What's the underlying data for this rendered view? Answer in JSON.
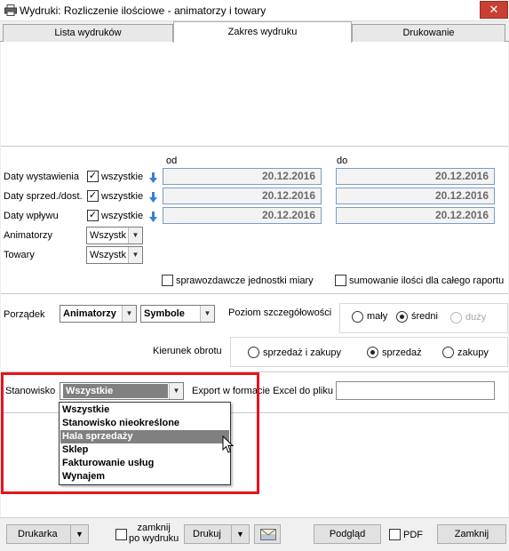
{
  "window": {
    "title": "Wydruki: Rozliczenie ilościowe - animatorzy i towary",
    "close_label": "✕"
  },
  "tabs": [
    {
      "label": "Lista wydruków"
    },
    {
      "label": "Zakres wydruku"
    },
    {
      "label": "Drukowanie"
    }
  ],
  "range": {
    "from_header": "od",
    "to_header": "do",
    "rows": [
      {
        "label": "Daty wystawienia",
        "all_label": "wszystkie",
        "checked": true,
        "from": "20.12.2016",
        "to": "20.12.2016"
      },
      {
        "label": "Daty sprzed./dost.",
        "all_label": "wszystkie",
        "checked": true,
        "from": "20.12.2016",
        "to": "20.12.2016"
      },
      {
        "label": "Daty wpływu",
        "all_label": "wszystkie",
        "checked": true,
        "from": "20.12.2016",
        "to": "20.12.2016"
      }
    ],
    "animators_label": "Animatorzy",
    "animators_value": "Wszystk",
    "goods_label": "Towary",
    "goods_value": "Wszystk",
    "reporting_units_label": "sprawozdawcze jednostki miary",
    "sum_quantities_label": "sumowanie ilości dla całego raportu"
  },
  "order": {
    "label": "Porządek",
    "primary": "Animatorzy",
    "secondary": "Symbole",
    "detail_label": "Poziom szczegółowości",
    "detail_options": [
      "mały",
      "średni",
      "duży"
    ],
    "detail_selected": "średni",
    "direction_label": "Kierunek obrotu",
    "direction_options": [
      "sprzedaż i zakupy",
      "sprzedaż",
      "zakupy"
    ],
    "direction_selected": "sprzedaż"
  },
  "station": {
    "label": "Stanowisko",
    "value": "Wszystkie",
    "export_label": "Export w formacie Excel do pliku",
    "export_value": "",
    "options": [
      "Wszystkie",
      "Stanowisko nieokreślone",
      "Hala sprzedaży",
      "Sklep",
      "Fakturowanie usług",
      "Wynajem"
    ],
    "highlighted": "Hala sprzedaży"
  },
  "footer": {
    "printer_label": "Drukarka",
    "close_after_print_label_1": "zamknij",
    "close_after_print_label_2": "po wydruku",
    "print_label": "Drukuj",
    "preview_label": "Podgląd",
    "pdf_label": "PDF",
    "close_label": "Zamknij"
  },
  "colors": {
    "accent_red": "#e8141b",
    "close_button": "#c84031",
    "date_border": "#7a9cc6",
    "highlight": "#808080"
  }
}
